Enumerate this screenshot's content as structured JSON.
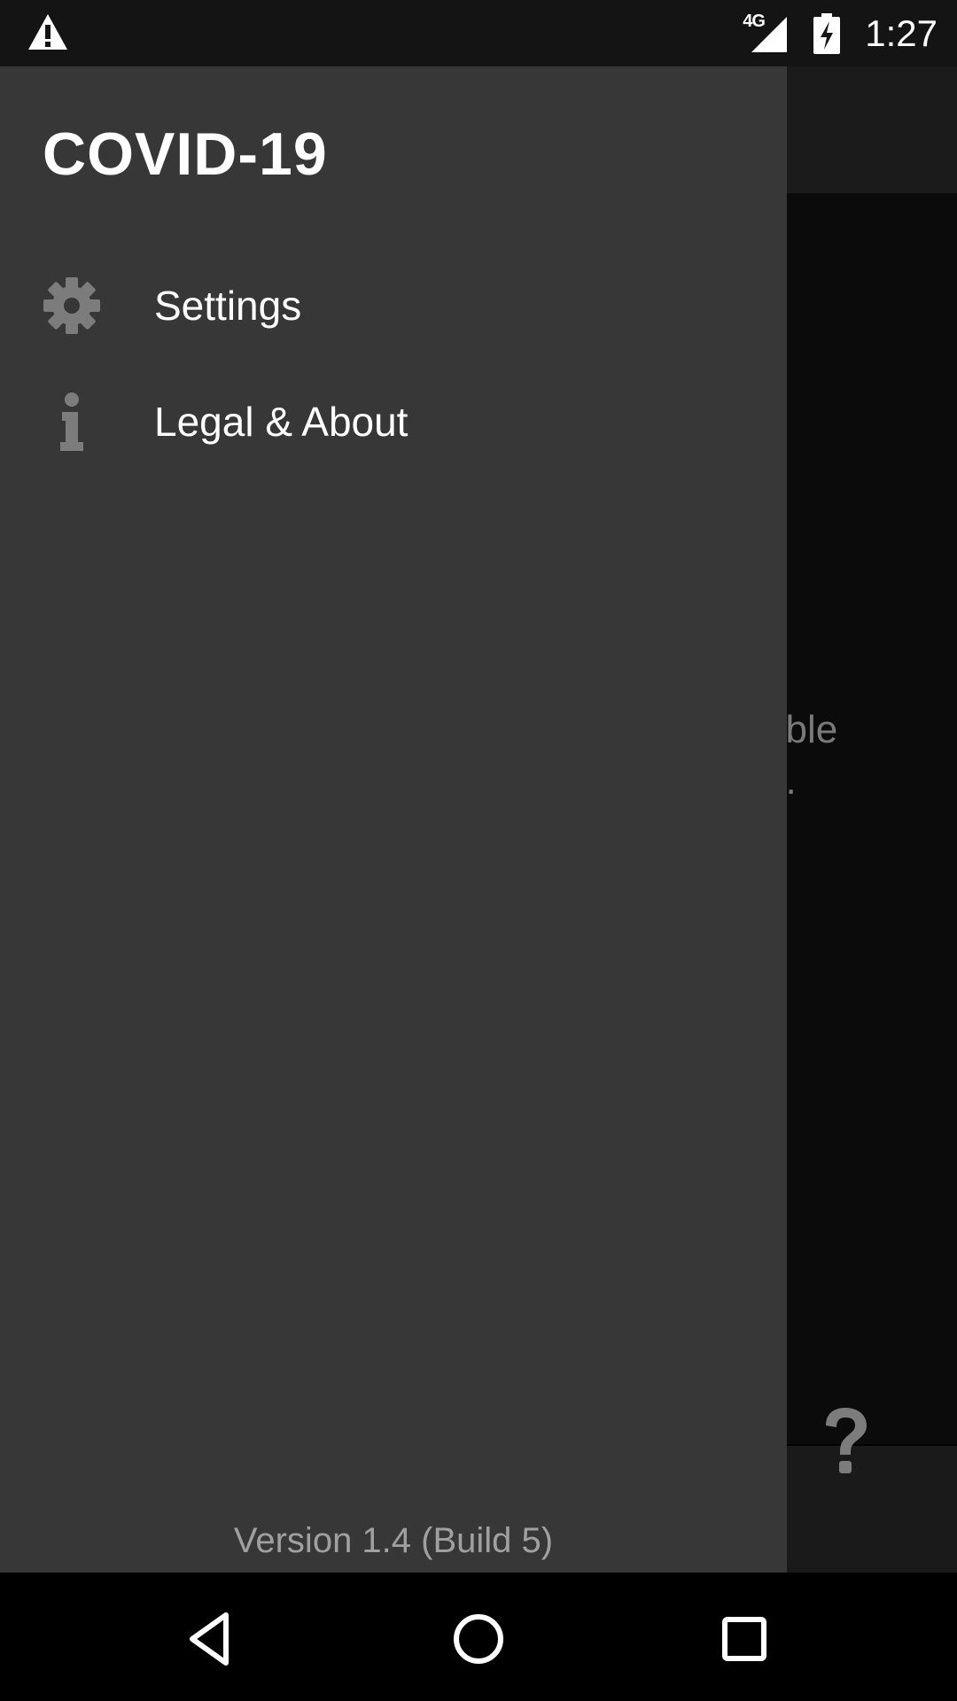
{
  "status_bar": {
    "alert_icon": "warning-icon",
    "network_label": "4G",
    "signal_icon": "signal-icon",
    "battery_icon": "battery-charging-icon",
    "time": "1:27"
  },
  "background_app": {
    "content_text": "able\nu.",
    "help_icon": "help-icon"
  },
  "drawer": {
    "title": "COVID-19",
    "items": [
      {
        "label": "Settings",
        "icon": "gear-icon"
      },
      {
        "label": "Legal & About",
        "icon": "info-icon"
      }
    ],
    "version": "Version 1.4 (Build 5)"
  },
  "nav_bar": {
    "back_icon": "back-icon",
    "home_icon": "home-icon",
    "recents_icon": "recents-icon"
  },
  "colors": {
    "drawer_bg": "#373737",
    "status_bar_bg": "#141414",
    "icon_gray": "#7c7c7c",
    "text_white": "#ffffff",
    "version_gray": "#a0a0a0"
  }
}
